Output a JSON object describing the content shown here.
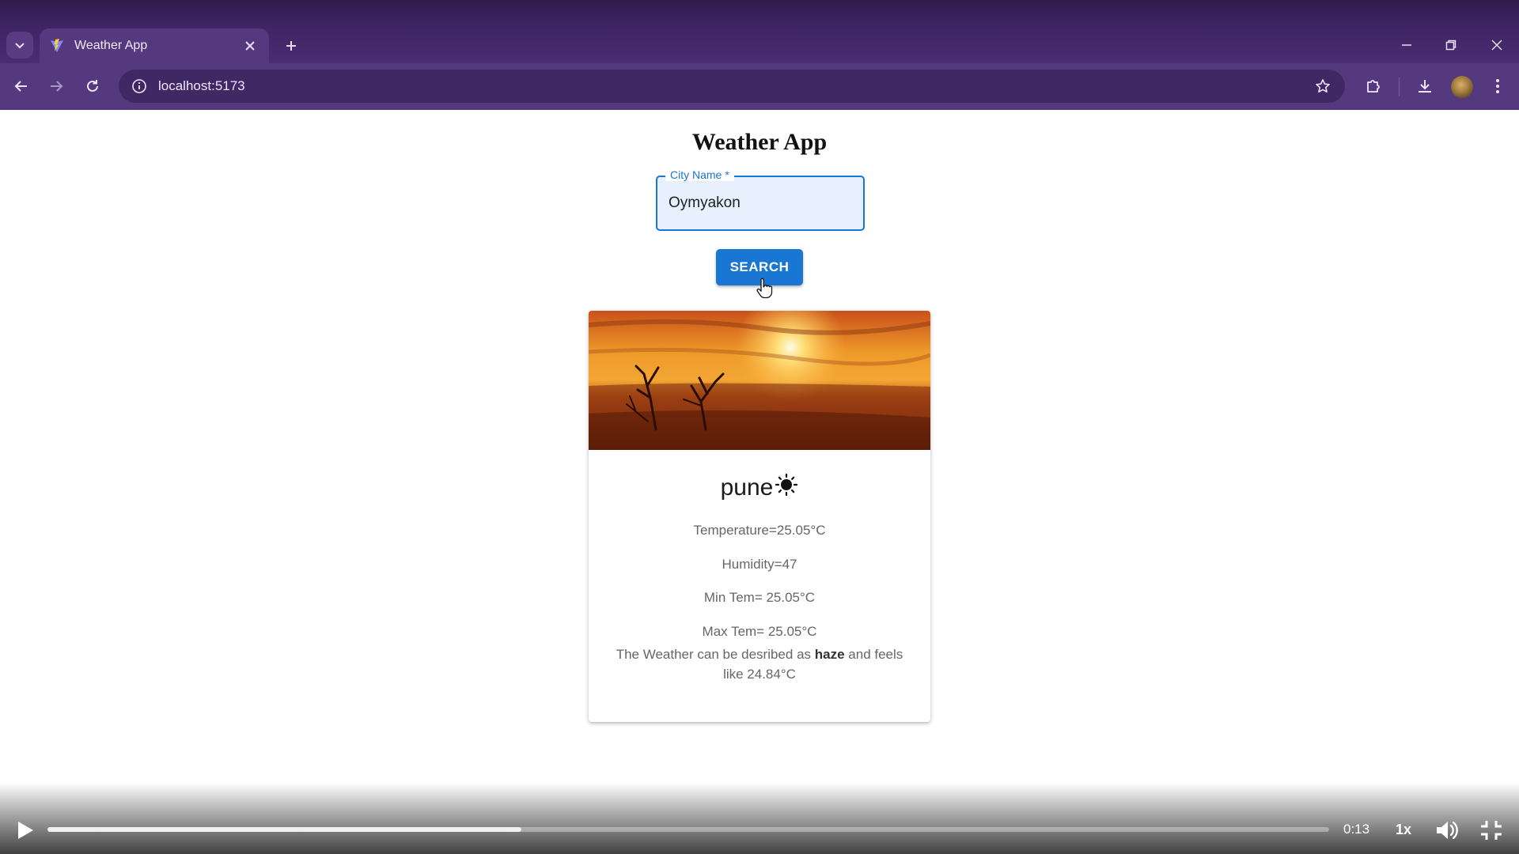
{
  "browser": {
    "tab_title": "Weather App",
    "url": "localhost:5173"
  },
  "app": {
    "title": "Weather App",
    "search": {
      "label": "City Name *",
      "value": "Oymyakon",
      "button_label": "SEARCH"
    },
    "card": {
      "city": "pune",
      "temperature": "Temperature=25.05°C",
      "humidity": "Humidity=47",
      "min_temp": "Min Tem= 25.05°C",
      "max_temp": "Max Tem= 25.05°C",
      "description_prefix": "The Weather can be desribed as",
      "description_condition": "haze",
      "description_suffix": "and feels like 24.84°C"
    }
  },
  "video": {
    "time": "0:13",
    "speed": "1x",
    "progress_percent": 37
  },
  "icons": {
    "weather": "sun-icon",
    "favicon": "vite-logo-icon"
  },
  "colors": {
    "primary": "#1976d2",
    "chrome_tab": "#55397f",
    "chrome_frame": "#2e1a4c"
  }
}
